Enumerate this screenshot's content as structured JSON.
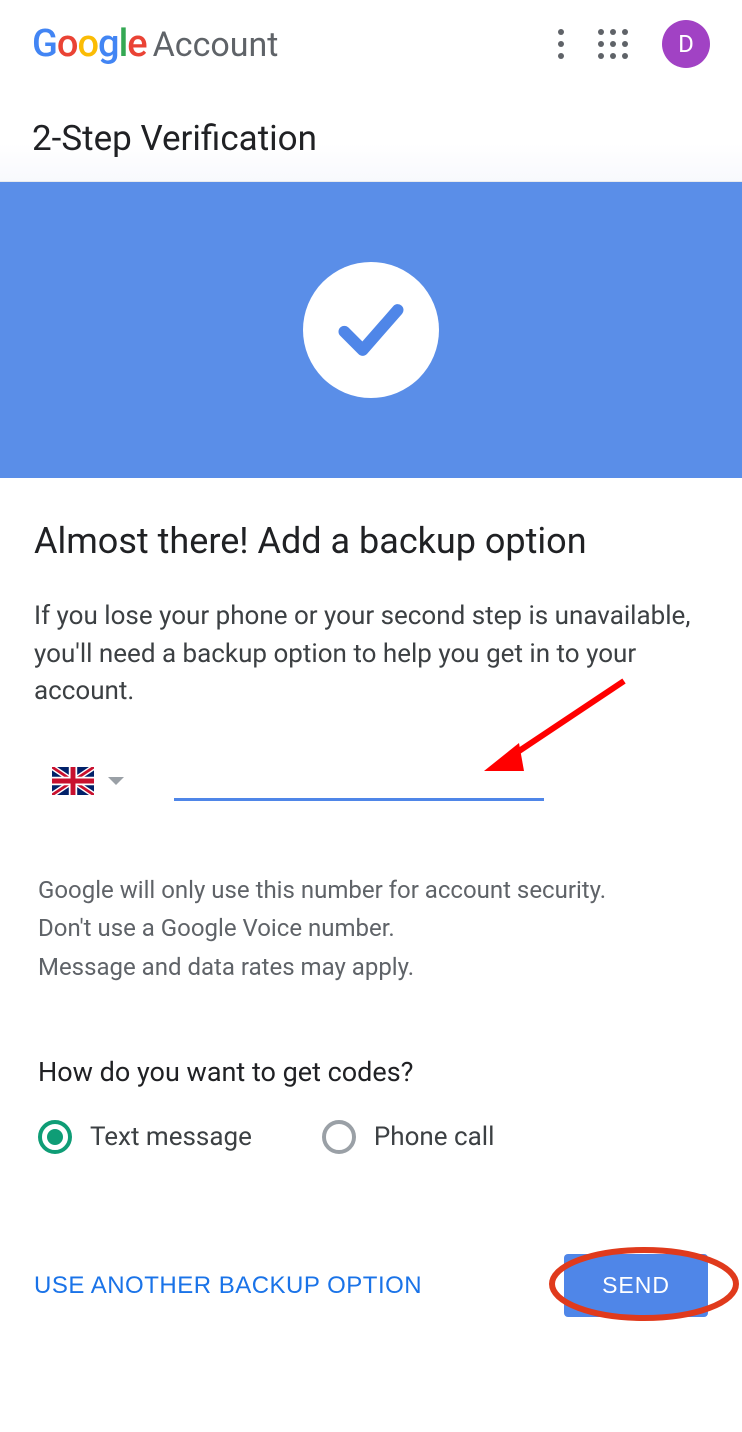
{
  "header": {
    "logo_text": "Google",
    "product_text": "Account",
    "avatar_initial": "D"
  },
  "page_title": "2-Step Verification",
  "main": {
    "heading": "Almost there! Add a backup option",
    "description": "If you lose your phone or your second step is unavailable, you'll need a backup option to help you get in to your account.",
    "phone_value": "",
    "disclaimer_line1": "Google will only use this number for account security.",
    "disclaimer_line2": "Don't use a Google Voice number.",
    "disclaimer_line3": "Message and data rates may apply.",
    "codes_question": "How do you want to get codes?",
    "radio_options": [
      {
        "label": "Text message",
        "selected": true
      },
      {
        "label": "Phone call",
        "selected": false
      }
    ]
  },
  "footer": {
    "alt_link": "USE ANOTHER BACKUP OPTION",
    "send_label": "SEND"
  }
}
